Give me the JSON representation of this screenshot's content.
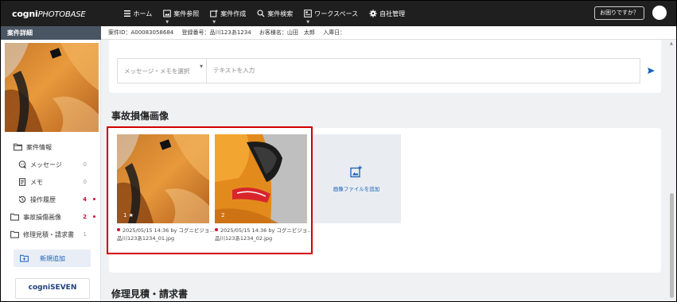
{
  "app": {
    "logo_main": "cogni",
    "logo_sub": "PHOTOBASE"
  },
  "nav": {
    "items": [
      {
        "label": "ホーム",
        "icon": "menu-icon"
      },
      {
        "label": "案件参照",
        "icon": "photo-icon"
      },
      {
        "label": "案件作成",
        "icon": "add-photo-icon"
      },
      {
        "label": "案件検索",
        "icon": "search-icon"
      },
      {
        "label": "ワークスペース",
        "icon": "workspace-icon"
      },
      {
        "label": "自社管理",
        "icon": "gear-icon"
      }
    ],
    "help_label": "お困りですか？"
  },
  "subheader": {
    "side_title": "案件詳細",
    "case_id": "案件ID：A00083058684",
    "reg_no": "登録番号：品川123あ1234",
    "customer": "お客様名：山田　太郎",
    "entry_date": "入庫日："
  },
  "sidebar": {
    "menu": [
      {
        "label": "案件情報",
        "count": "",
        "icon": "folder-icon"
      },
      {
        "label": "メッセージ",
        "count": "0",
        "icon": "chat-icon"
      },
      {
        "label": "メモ",
        "count": "0",
        "icon": "memo-icon"
      },
      {
        "label": "操作履歴",
        "count": "4",
        "icon": "history-icon"
      },
      {
        "label": "事故損傷画像",
        "count": "2",
        "icon": "folder-icon"
      },
      {
        "label": "修理見積・請求書",
        "count": "1",
        "icon": "folder-icon"
      }
    ],
    "add_new_label": "新規追加",
    "brand_label": "cogniSEVEN"
  },
  "message": {
    "select_placeholder": "メッセージ・メモを選択",
    "text_placeholder": "テキストを入力"
  },
  "damage_section": {
    "title": "事故損傷画像",
    "images": [
      {
        "num": "1 ★",
        "date_line": "2025/05/15 14:36 by コグニビジョ…",
        "filename": "品川123あ1234_01.jpg"
      },
      {
        "num": "2",
        "date_line": "2025/05/15 14:36 by コグニビジョ…",
        "filename": "品川123あ1234_02.jpg"
      }
    ],
    "add_label": "画像ファイルを追加"
  },
  "estimate_section": {
    "title": "修理見積・請求書"
  },
  "colors": {
    "nav_bg": "#1f1f1f",
    "accent_blue": "#1a5fb4",
    "alert_red": "#c8102e",
    "highlight_red": "#d10000"
  }
}
